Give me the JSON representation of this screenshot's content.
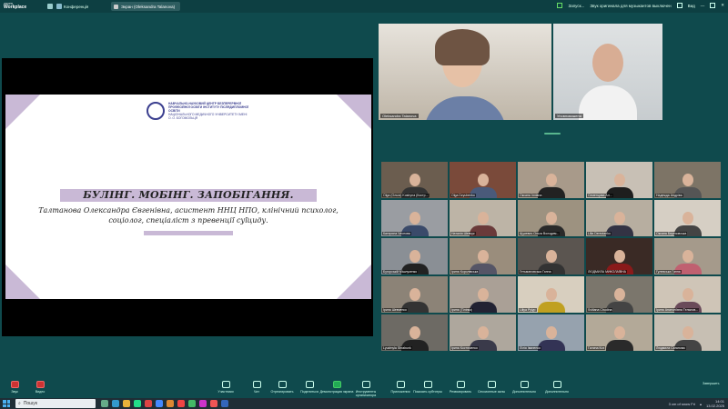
{
  "topbar": {
    "logo_line1": "zoom",
    "logo_line2": "Workplace",
    "conference_label": "Конференція",
    "viewing_name": "Экран (Oleksandra Talanova)",
    "sound_label": "Запуск...",
    "original_sound": "Звук оригинала для музыкантов выключен",
    "view_label": "Вид"
  },
  "slide": {
    "org_name": "НАВЧАЛЬНО-НАУКОВИЙ ЦЕНТР БЕЗПЕРЕРВНОЇ ПРОФЕСІЙНОЇ ОСВІТИ ІНСТИТУТУ ПІСЛЯДИПЛОМНОЇ ОСВІТИ",
    "org_sub": "НАЦІОНАЛЬНОГО МЕДИЧНОГО УНІВЕРСИТЕТУ ІМЕНІ О. О. БОГОМОЛЬЦЯ",
    "title": "БУЛІНГ. МОБІНГ. ЗАПОБІГАННЯ.",
    "subtitle": "Талтанова Олександра Євгенівна, асистент ННЦ НПО, клінічний психолог, соціолог, спеціаліст з превенції суїциду."
  },
  "speakers": [
    {
      "label": "Oleksandra Talanova"
    },
    {
      "label": "Уповноважена"
    }
  ],
  "gallery": [
    {
      "label": "Olga (Ольга) Kostryna (Костр...",
      "bg": "#6b5d4f",
      "shirt": "#333"
    },
    {
      "label": "Olga Dzyubenko",
      "bg": "#7a4a3a",
      "shirt": "#4a5a7a"
    },
    {
      "label": "Оксана Іллівна",
      "bg": "#a89a8a",
      "shirt": "#222"
    },
    {
      "label": "Семенцова Ал...",
      "bg": "#c8c0b5",
      "shirt": "#1e1e1e"
    },
    {
      "label": "Надежда Андріюк",
      "bg": "#7d7466",
      "shirt": "#555"
    },
    {
      "label": "Катерина Чеснова",
      "bg": "#9a9da2",
      "shirt": "#3a4a6a"
    },
    {
      "label": "Наталія Шевчук",
      "bg": "#bdb4a6",
      "shirt": "#6a3a3a"
    },
    {
      "label": "Щукевич Ольга Володим...",
      "bg": "#9d9280",
      "shirt": "#2a2a2a"
    },
    {
      "label": "Lilia Derevianko",
      "bg": "#b7aea0",
      "shirt": "#334"
    },
    {
      "label": "Оксана Березовська",
      "bg": "#d6cfc4",
      "shirt": "#444"
    },
    {
      "label": "Бугорській Мішлукенко",
      "bg": "#8a8f95",
      "shirt": "#222"
    },
    {
      "label": "Ірина Королівська",
      "bg": "#9a8d7c",
      "shirt": "#556"
    },
    {
      "label": "Гетьмановська Ганна",
      "bg": "#5b5550",
      "shirt": "#333"
    },
    {
      "label": "ЛЮДМИЛА МИКОЛАЇВНА",
      "bg": "#3a2a25",
      "shirt": "#8a1a1a"
    },
    {
      "label": "Гулевська Ганна",
      "bg": "#a59a8b",
      "shirt": "#c06070"
    },
    {
      "label": "Ірина Шевченко",
      "bg": "#8c8377",
      "shirt": "#333"
    },
    {
      "label": "Ірина (Тіліпко)",
      "bg": "#aaa096",
      "shirt": "#223"
    },
    {
      "label": "Liliya Pylyp",
      "bg": "#d8cfbf",
      "shirt": "#c0a020"
    },
    {
      "label": "Svitlana Chudina",
      "bg": "#7b766c",
      "shirt": "#444"
    },
    {
      "label": "Ірина Анатоліївна Тельнов...",
      "bg": "#cfc5b7",
      "shirt": "#6a4a5a"
    },
    {
      "label": "Lyudmyla Shrabunk",
      "bg": "#6d6a64",
      "shirt": "#222"
    },
    {
      "label": "Ірина Костюченко",
      "bg": "#aea79d",
      "shirt": "#3a3a4a"
    },
    {
      "label": "Лілія Іваненко",
      "bg": "#96a2ae",
      "shirt": "#335"
    },
    {
      "label": "Галина Кох",
      "bg": "#b3a998",
      "shirt": "#2a2a2a"
    },
    {
      "label": "Людмила Саганова",
      "bg": "#c7bfb3",
      "shirt": "#444"
    }
  ],
  "toolbar": {
    "audio": "Звук",
    "video": "Видео",
    "participants": "Участники",
    "chat": "Чат",
    "react": "Отреагировать",
    "share": "Поделиться",
    "share_screen": "Демонстрация экрана",
    "host_tools": "Инструменты организатора",
    "apps": "Приложения",
    "caption": "Показать субтитры",
    "summary": "Резюмировать",
    "breakout": "Сессионные залы",
    "record": "Дополнительно",
    "more": "Дополнительно",
    "leave": "Завершить"
  },
  "taskbar": {
    "search_placeholder": "Пошук",
    "tray_info": "3 cm of snow Fri",
    "time": "14:01",
    "date": "13.02.2025"
  }
}
